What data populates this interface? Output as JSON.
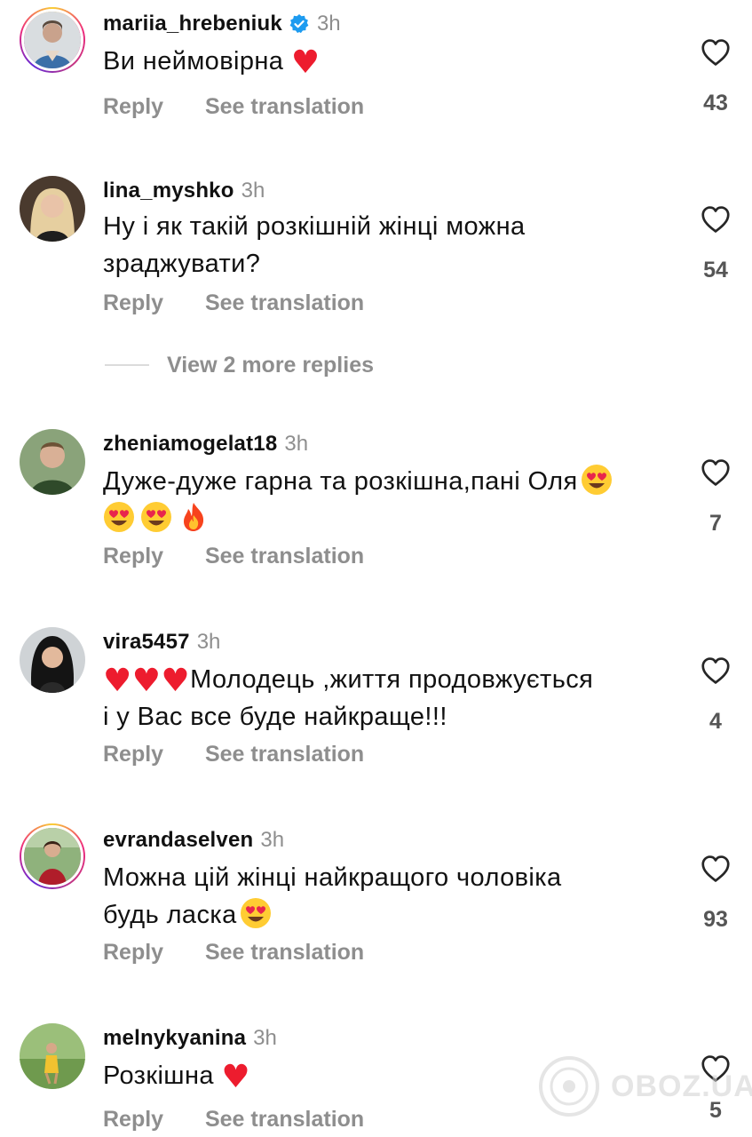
{
  "actions": {
    "reply": "Reply",
    "see_translation": "See translation"
  },
  "view_more_replies": "View 2 more replies",
  "comments": [
    {
      "username": "mariia_hrebeniuk",
      "verified": true,
      "time": "3h",
      "text": "Ви неймовірна",
      "likes": "43",
      "story_ring": true
    },
    {
      "username": "lina_myshko",
      "time": "3h",
      "text_line1": "Ну і як такій розкішній жінці можна",
      "text_line2": "зраджувати?",
      "likes": "54"
    },
    {
      "username": "zheniamogelat18",
      "time": "3h",
      "text": "Дуже-дуже гарна та розкішна,пані Оля",
      "likes": "7"
    },
    {
      "username": "vira5457",
      "time": "3h",
      "text_line1": "Молодець ,життя продовжується",
      "text_line2": "і у Вас все буде найкраще!!!",
      "likes": "4"
    },
    {
      "username": "evrandaselven",
      "time": "3h",
      "text_line1": "Можна цій жінці найкращого чоловіка",
      "text_line2": "будь ласка",
      "likes": "93",
      "story_ring": true
    },
    {
      "username": "melnykyanina",
      "time": "3h",
      "text": "Розкішна",
      "likes": "5"
    }
  ],
  "icons": {
    "like": "heart-outline-icon",
    "verified": "verified-badge-icon",
    "watermark": "obozrevatel-logo-icon"
  },
  "colors": {
    "verified": "#1d9bf0",
    "secondary_text": "#8e8e8e",
    "heart_emoji": "#ed1c2e"
  },
  "watermark_text": "OBOZ.UA"
}
